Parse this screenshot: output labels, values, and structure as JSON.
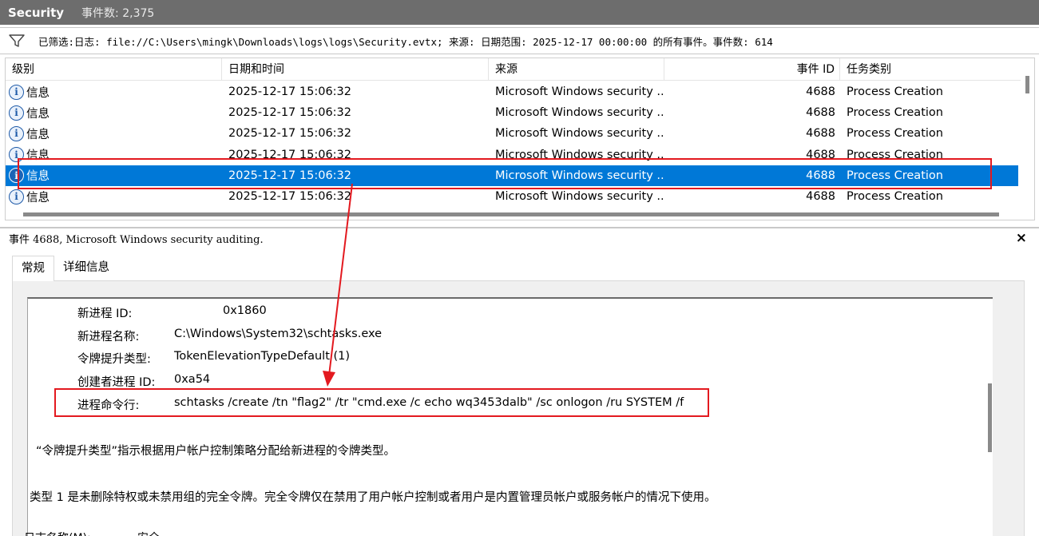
{
  "titlebar": {
    "log_name": "Security",
    "event_count": "事件数: 2,375"
  },
  "filter": {
    "icon": "funnel-icon",
    "text": "已筛选:日志: file://C:\\Users\\mingk\\Downloads\\logs\\logs\\Security.evtx; 来源: 日期范围: 2025-12-17 00:00:00 的所有事件。事件数: 614"
  },
  "grid": {
    "columns": [
      "级别",
      "日期和时间",
      "来源",
      "事件 ID",
      "任务类别"
    ],
    "rows": [
      {
        "level": "信息",
        "datetime": "2025-12-17 15:06:32",
        "source": "Microsoft Windows security ...",
        "event_id": "4688",
        "task": "Process Creation"
      },
      {
        "level": "信息",
        "datetime": "2025-12-17 15:06:32",
        "source": "Microsoft Windows security ...",
        "event_id": "4688",
        "task": "Process Creation"
      },
      {
        "level": "信息",
        "datetime": "2025-12-17 15:06:32",
        "source": "Microsoft Windows security ...",
        "event_id": "4688",
        "task": "Process Creation"
      },
      {
        "level": "信息",
        "datetime": "2025-12-17 15:06:32",
        "source": "Microsoft Windows security ...",
        "event_id": "4688",
        "task": "Process Creation"
      },
      {
        "level": "信息",
        "datetime": "2025-12-17 15:06:32",
        "source": "Microsoft Windows security ...",
        "event_id": "4688",
        "task": "Process Creation"
      },
      {
        "level": "信息",
        "datetime": "2025-12-17 15:06:32",
        "source": "Microsoft Windows security ...",
        "event_id": "4688",
        "task": "Process Creation"
      }
    ],
    "selected_index": 4
  },
  "detail": {
    "header": "事件 4688, Microsoft Windows security auditing.",
    "close": "×",
    "tabs": [
      "常规",
      "详细信息"
    ],
    "fields": [
      {
        "label": "新进程 ID:",
        "value": "0x1860"
      },
      {
        "label": "新进程名称:",
        "value": "C:\\Windows\\System32\\schtasks.exe"
      },
      {
        "label": "令牌提升类型:",
        "value": "TokenElevationTypeDefault (1)"
      },
      {
        "label": "创建者进程 ID:",
        "value": "0xa54"
      },
      {
        "label": "进程命令行:",
        "value": "schtasks  /create /tn \"flag2\" /tr \"cmd.exe /c echo wq3453dalb\" /sc onlogon /ru SYSTEM /f"
      }
    ],
    "note1": "“令牌提升类型”指示根据用户帐户控制策略分配给新进程的令牌类型。",
    "note2": "类型 1 是未删除特权或未禁用组的完全令牌。完全令牌仅在禁用了用户帐户控制或者用户是内置管理员帐户或服务帐户的情况下使用。",
    "bottom_label": "日志名称(M):",
    "bottom_value": "安全"
  },
  "colors": {
    "selection": "#0078d7",
    "annotation": "#e3191f",
    "titlebar": "#6d6d6d"
  }
}
